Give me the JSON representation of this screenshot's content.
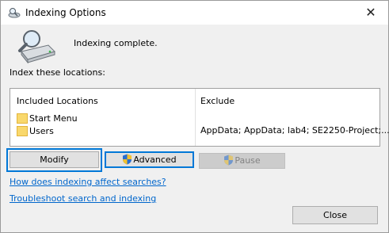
{
  "window": {
    "title": "Indexing Options",
    "close_glyph": "✕"
  },
  "status": {
    "message": "Indexing complete."
  },
  "locations": {
    "section_label": "Index these locations:",
    "headers": [
      "Included Locations",
      "Exclude"
    ],
    "rows": [
      {
        "name": "Start Menu",
        "exclude": ""
      },
      {
        "name": "Users",
        "exclude": "AppData; AppData; lab4; SE2250-Project;..."
      }
    ]
  },
  "buttons": {
    "modify": "Modify",
    "advanced": "Advanced",
    "pause": "Pause",
    "close": "Close"
  },
  "links": {
    "how_indexing": "How does indexing affect searches?",
    "troubleshoot": "Troubleshoot search and indexing"
  },
  "colors": {
    "accent": "#0078d7",
    "link": "#0066cc",
    "folder": "#f9d86c"
  },
  "icons": [
    "indexing-options-icon",
    "magnifier-drive-icon",
    "folder-icon",
    "uac-shield-icon",
    "close-icon"
  ]
}
